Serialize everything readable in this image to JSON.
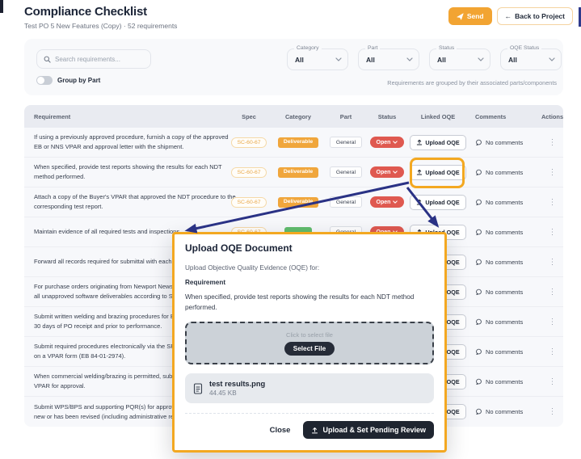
{
  "page": {
    "title": "Compliance Checklist",
    "subtitle": "Test PO 5 New Features (Copy) · 52 requirements"
  },
  "toolbar": {
    "send": "Send",
    "back": "Back to Project"
  },
  "filters": {
    "search_placeholder": "Search requirements...",
    "group_by_label": "Group by Part",
    "note": "Requirements are grouped by their associated parts/components",
    "dropdowns": [
      {
        "label": "Category",
        "value": "All"
      },
      {
        "label": "Part",
        "value": "All"
      },
      {
        "label": "Status",
        "value": "All"
      },
      {
        "label": "OQE Status",
        "value": "All"
      }
    ]
  },
  "table": {
    "columns": [
      "Requirement",
      "Spec",
      "Category",
      "Part",
      "Status",
      "Linked OQE",
      "Comments",
      "Actions"
    ],
    "rows": [
      {
        "lines": [
          "If using a previously approved procedure, furnish a copy of the approved",
          "EB or NNS VPAR and approval letter with the shipment."
        ],
        "spec": "SC-60-67",
        "category": {
          "label": "Deliverable",
          "color": "#f0a63c"
        },
        "part": "General",
        "status": "Open",
        "oqe_button": "Upload OQE",
        "comments": "No comments"
      },
      {
        "lines": [
          "When specified, provide test reports showing the results for each NDT",
          "method performed."
        ],
        "spec": "SC-60-67",
        "category": {
          "label": "Deliverable",
          "color": "#f0a63c"
        },
        "part": "General",
        "status": "Open",
        "oqe_button": "Upload OQE",
        "comments": "No comments",
        "highlighted": true
      },
      {
        "lines": [
          "Attach a copy of the Buyer's VPAR that approved the NDT procedure to the",
          "corresponding test report."
        ],
        "spec": "SC-60-67",
        "category": {
          "label": "Deliverable",
          "color": "#f0a63c"
        },
        "part": "General",
        "status": "Open",
        "oqe_button": "Upload OQE",
        "comments": "No comments"
      },
      {
        "lines": [
          "Maintain evidence of all required tests and inspections"
        ],
        "spec": "SC-60-67",
        "category": {
          "label": "",
          "color": "#61bd6d"
        },
        "part": "General",
        "status": "Open",
        "oqe_button": "Upload OQE",
        "comments": "No comments"
      },
      {
        "lines": [
          "Forward all records required for submittal with each sh"
        ],
        "spec": null,
        "category": null,
        "part": null,
        "status": null,
        "oqe_button": "Upload OQE",
        "comments": "No comments"
      },
      {
        "lines": [
          "For purchase orders originating from Newport News S",
          "all unapproved software deliverables according to Sta"
        ],
        "spec": null,
        "category": null,
        "part": null,
        "status": null,
        "oqe_button": "Upload OQE",
        "comments": "No comments"
      },
      {
        "lines": [
          "Submit written welding and brazing procedures for Bu",
          "30 days of PO receipt and prior to performance."
        ],
        "spec": null,
        "category": null,
        "part": null,
        "status": null,
        "oqe_button": "Upload OQE",
        "comments": "No comments"
      },
      {
        "lines": [
          "Submit required procedures electronically via the SPA",
          "on a VPAR form (EB 84-01-2974)."
        ],
        "spec": null,
        "category": null,
        "part": null,
        "status": null,
        "oqe_button": "Upload OQE",
        "comments": "No comments"
      },
      {
        "lines": [
          "When commercial welding/brazing is permitted, submi",
          "VPAR for approval."
        ],
        "spec": null,
        "category": null,
        "part": null,
        "status": null,
        "oqe_button": "Upload OQE",
        "comments": "No comments"
      },
      {
        "lines": [
          "Submit WPS/BPS and supporting PQR(s) for approval",
          "new or has been revised (including administrative revis"
        ],
        "spec": null,
        "category": null,
        "part": null,
        "status": null,
        "oqe_button": "Upload OQE",
        "comments": "No comments"
      }
    ]
  },
  "modal": {
    "title": "Upload OQE Document",
    "intro": "Upload Objective Quality Evidence (OQE) for:",
    "section_label": "Requirement",
    "requirement_text": "When specified, provide test reports showing the results for each NDT method performed.",
    "dropzone_hint": "Click to select file",
    "select_file_label": "Select File",
    "file": {
      "name": "test results.png",
      "size": "44.45 KB"
    },
    "close_label": "Close",
    "submit_label": "Upload & Set Pending Review"
  },
  "colors": {
    "accent_orange": "#f2a432",
    "highlight_orange": "#f3a821",
    "arrow_navy": "#2a3285",
    "status_open_red": "#df5950",
    "category_orange": "#f0a63c",
    "category_green": "#61bd6d",
    "dark_button": "#1f2530"
  }
}
